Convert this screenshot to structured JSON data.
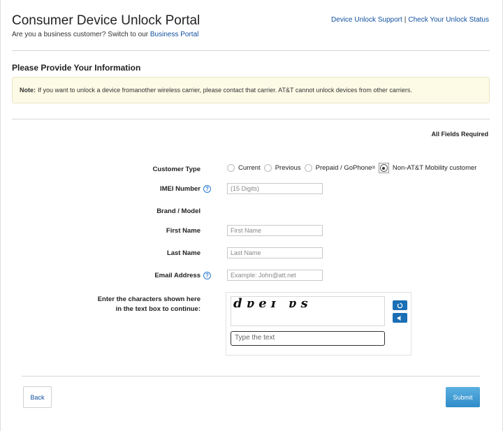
{
  "header": {
    "title": "Consumer Device Unlock Portal",
    "subline_prefix": "Are you a business customer? Switch to our",
    "business_link": "Business Portal",
    "support_link": "Device Unlock Support",
    "status_link": "Check Your Unlock Status"
  },
  "form": {
    "section_title": "Please Provide Your Information",
    "note_label": "Note:",
    "note_text": "If you want to unlock a device fromanother wireless carrier, please contact that carrier. AT&T cannot unlock devices from other carriers.",
    "required_text": "All Fields Required",
    "customer_type_label": "Customer Type",
    "customer_type_options": [
      "Current",
      "Previous",
      "Prepaid / GoPhone",
      "Non-AT&T Mobility customer"
    ],
    "prepaid_sup": "®",
    "customer_type_selected": "Non-AT&T Mobility customer",
    "imei_label": "IMEI Number",
    "imei_placeholder": "(15 Digits)",
    "brand_label": "Brand / Model",
    "first_name_label": "First Name",
    "first_name_placeholder": "First Name",
    "last_name_label": "Last Name",
    "last_name_placeholder": "Last Name",
    "email_label": "Email Address",
    "email_placeholder": "Example: John@att.net",
    "captcha_label_line1": "Enter the characters shown here",
    "captcha_label_line2": "in the text box to continue:",
    "captcha_chars": "dɐeɪ ɐs",
    "captcha_input_placeholder": "Type the text",
    "help_glyph": "?"
  },
  "actions": {
    "back_label": "Back",
    "submit_label": "Submit"
  },
  "icons": {
    "refresh": "refresh-icon",
    "audio": "audio-icon"
  },
  "colors": {
    "link": "#0f4f9e",
    "note_bg": "#fdfbe6",
    "submit": "#2f8cc9",
    "captcha_btn": "#1a6fb5"
  }
}
